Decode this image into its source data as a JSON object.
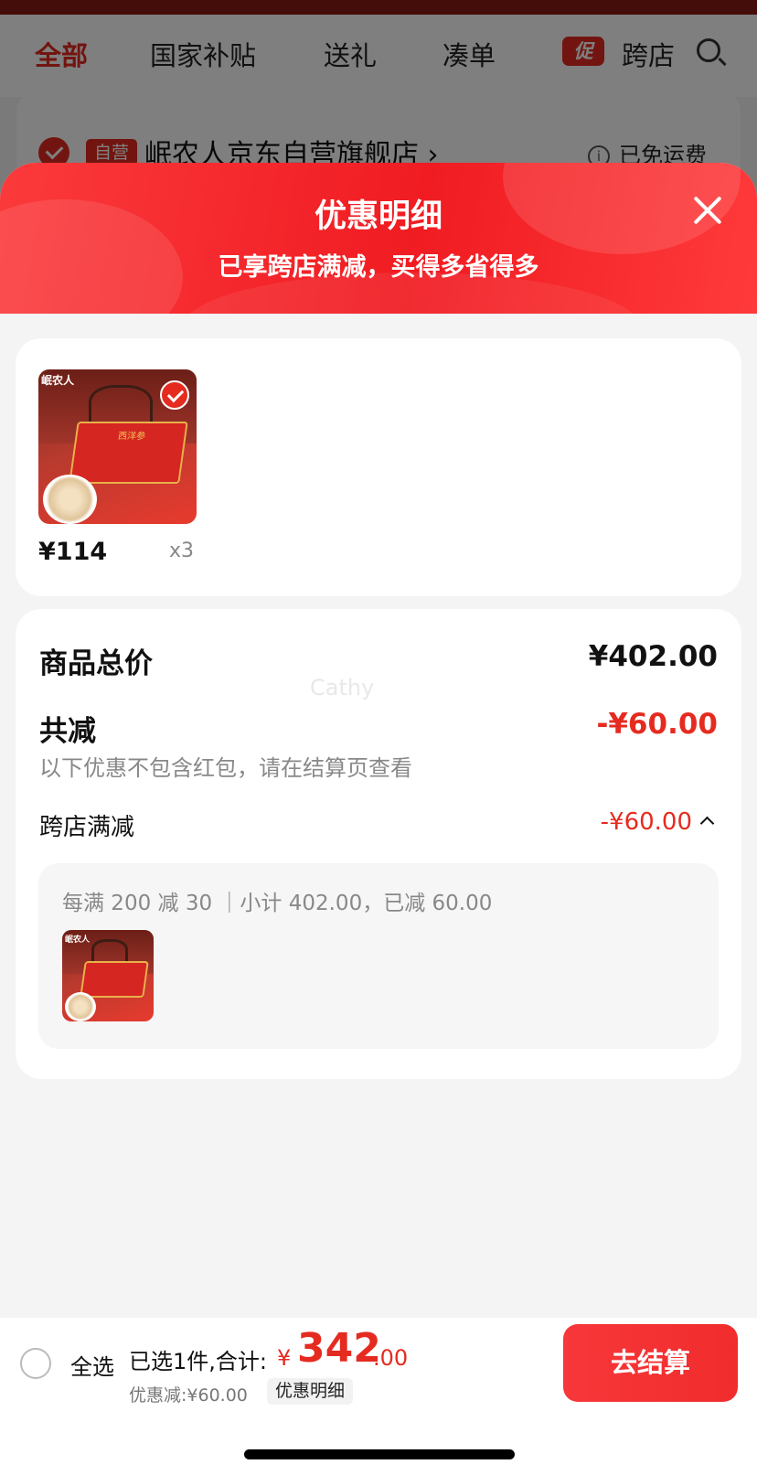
{
  "background_page": {
    "tabs": [
      {
        "label": "全部",
        "active": true
      },
      {
        "label": "国家补贴",
        "active": false
      },
      {
        "label": "送礼",
        "active": false
      },
      {
        "label": "凑单",
        "active": false
      },
      {
        "label": "跨店",
        "active": false
      }
    ],
    "promo_badge": "促",
    "search_icon": "search-icon",
    "store": {
      "self_operated_badge": "自营",
      "name": "岷农人京东自营旗舰店 ›",
      "shipping_icon": "info-icon",
      "shipping": "已免运费"
    }
  },
  "sheet": {
    "title": "优惠明细",
    "subtitle": "已享跨店满减，买得多省得多",
    "close_icon": "close-icon",
    "product": {
      "brand_text": "岷农人",
      "price": "¥114",
      "quantity": "x3",
      "selected": true
    },
    "summary": {
      "total_label": "商品总价",
      "total_value": "¥402.00",
      "watermark": "Cathy",
      "discount_label": "共减",
      "discount_value": "-¥60.00",
      "note": "以下优惠不包含红包，请在结算页查看",
      "promo_label": "跨店满减",
      "promo_value": "-¥60.00",
      "promo_detail": "每满 200 减 30 ｜小计 402.00，已减 60.00",
      "promo_product_brand": "岷农人"
    }
  },
  "bottom_bar": {
    "select_all": "全选",
    "selected_count": "已选1件,合计:",
    "currency": "¥",
    "total_integer": "342",
    "total_decimal": ".00",
    "discount_text": "优惠减:¥60.00",
    "discount_detail_link": "优惠明细",
    "checkout_button": "去结算"
  },
  "colors": {
    "accent": "#e52b20",
    "header_gradient_start": "#fb3a3c",
    "header_gradient_end": "#f01c22"
  }
}
